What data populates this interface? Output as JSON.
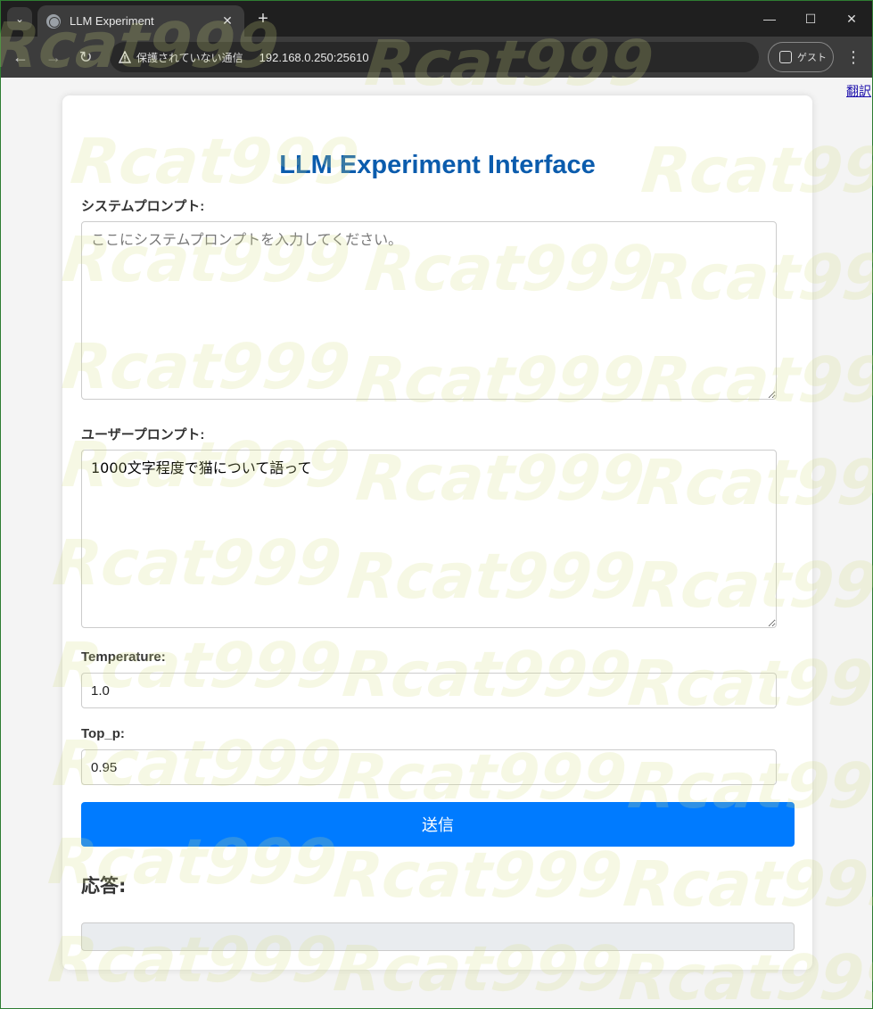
{
  "browser": {
    "tab_title": "LLM Experiment",
    "security_text": "保護されていない通信",
    "url": "192.168.0.250:25610",
    "profile_label": "ゲスト"
  },
  "page": {
    "translate_link": "翻訳",
    "title": "LLM Experiment Interface",
    "system_prompt": {
      "label": "システムプロンプト:",
      "placeholder": "ここにシステムプロンプトを入力してください。",
      "value": ""
    },
    "user_prompt": {
      "label": "ユーザープロンプト:",
      "value": "1000文字程度で猫について語って"
    },
    "temperature": {
      "label": "Temperature:",
      "value": "1.0"
    },
    "top_p": {
      "label": "Top_p:",
      "value": "0.95"
    },
    "submit_label": "送信",
    "response_heading": "応答:",
    "response_text": ""
  },
  "watermark": {
    "text": "Rcat999"
  },
  "colors": {
    "title": "#0b5cad",
    "submit_bg": "#007bff",
    "response_bg": "#e9ecef"
  }
}
